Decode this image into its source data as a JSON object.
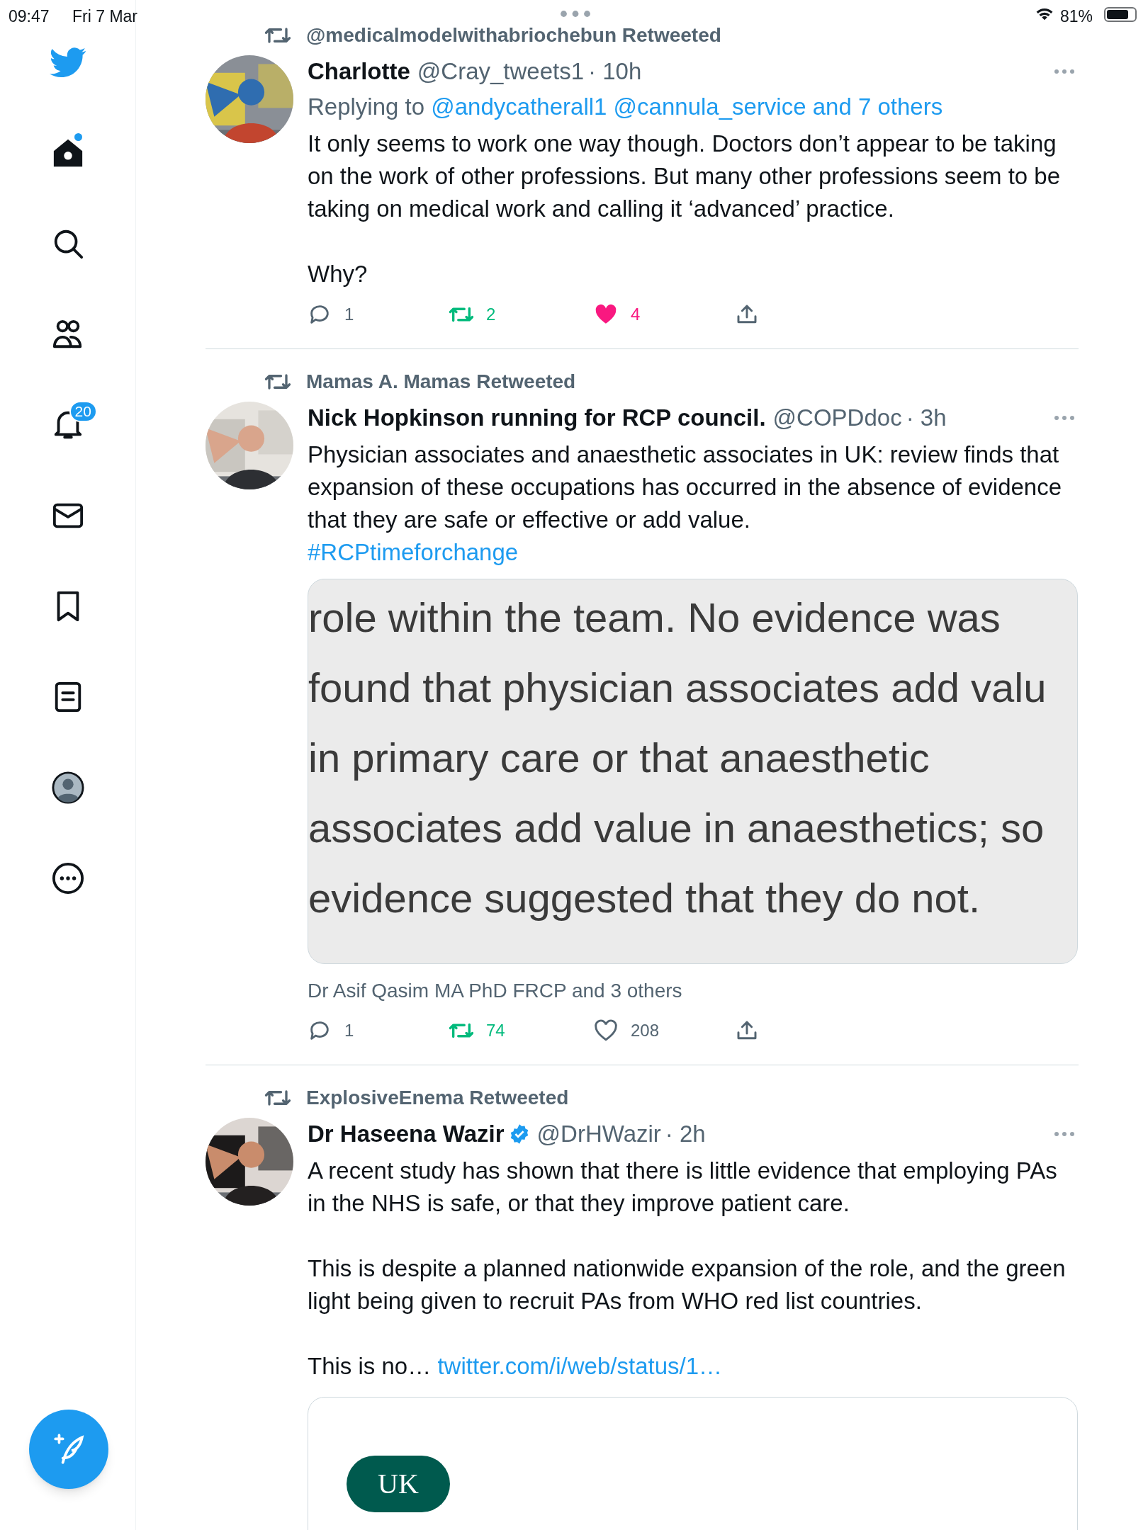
{
  "status_bar": {
    "time": "09:47",
    "date": "Fri 7 Mar",
    "battery": "81%"
  },
  "sidebar": {
    "items": [
      {
        "kind": "logo"
      },
      {
        "kind": "home",
        "unread_dot": true
      },
      {
        "kind": "search"
      },
      {
        "kind": "communities"
      },
      {
        "kind": "notifications",
        "badge": "20"
      },
      {
        "kind": "messages"
      },
      {
        "kind": "bookmarks"
      },
      {
        "kind": "lists"
      },
      {
        "kind": "profile"
      },
      {
        "kind": "more"
      }
    ],
    "compose": {
      "kind": "compose"
    }
  },
  "tweets": [
    {
      "retweeted_by": "@medicalmodelwithabriochebun Retweeted",
      "name": "Charlotte",
      "handle": "@Cray_tweets1",
      "time": "· 10h",
      "reply_prefix": "Replying to",
      "reply_to": "@andycatherall1 @cannula_service and 7 others",
      "paragraphs": [
        {
          "kind": "text",
          "text": "It only seems to work one way though. Doctors don’t appear to be taking on the work of other professions. But many other professions seem to be taking on medical work and calling it ‘advanced’ practice."
        },
        {
          "kind": "text",
          "text": "Why?"
        }
      ],
      "actions": {
        "replies": "1",
        "retweets": "2",
        "likes": "4",
        "retweeted": true,
        "liked": true
      }
    },
    {
      "retweeted_by": "Mamas A. Mamas Retweeted",
      "name": "Nick Hopkinson running for RCP council.",
      "handle": "@COPDdoc",
      "time": "· 3h",
      "paragraphs": [
        {
          "kind": "text",
          "text": "Physician associates and anaesthetic associates in UK: review finds that  expansion of these occupations has occurred in the absence of evidence that they are safe or effective or add value."
        },
        {
          "kind": "hashtag",
          "text": "#RCPtimeforchange"
        }
      ],
      "media": {
        "kind": "text-image",
        "lines": [
          "role within the team. No evidence was",
          "found that physician associates add valu",
          "in primary care or that anaesthetic",
          "associates add value in anaesthetics; so",
          "evidence suggested that they do not."
        ]
      },
      "liked_by": "Dr Asif Qasim MA PhD FRCP and 3 others",
      "actions": {
        "replies": "1",
        "retweets": "74",
        "likes": "208",
        "retweeted": true,
        "liked": false
      }
    },
    {
      "retweeted_by": "ExplosiveEnema Retweeted",
      "name": "Dr Haseena Wazir",
      "verified": true,
      "handle": "@DrHWazir",
      "time": "· 2h",
      "paragraphs": [
        {
          "kind": "text",
          "text": "A recent study has shown that there is little evidence that employing PAs in the NHS is safe, or that they improve patient care."
        },
        {
          "kind": "text",
          "text": "This is despite a planned nationwide expansion of the role, and the green light being given to recruit PAs from WHO red list countries."
        },
        {
          "kind": "text",
          "text": "This is no…",
          "link": "twitter.com/i/web/status/1…"
        }
      ],
      "media": {
        "kind": "link-card",
        "label": "UK"
      }
    }
  ]
}
